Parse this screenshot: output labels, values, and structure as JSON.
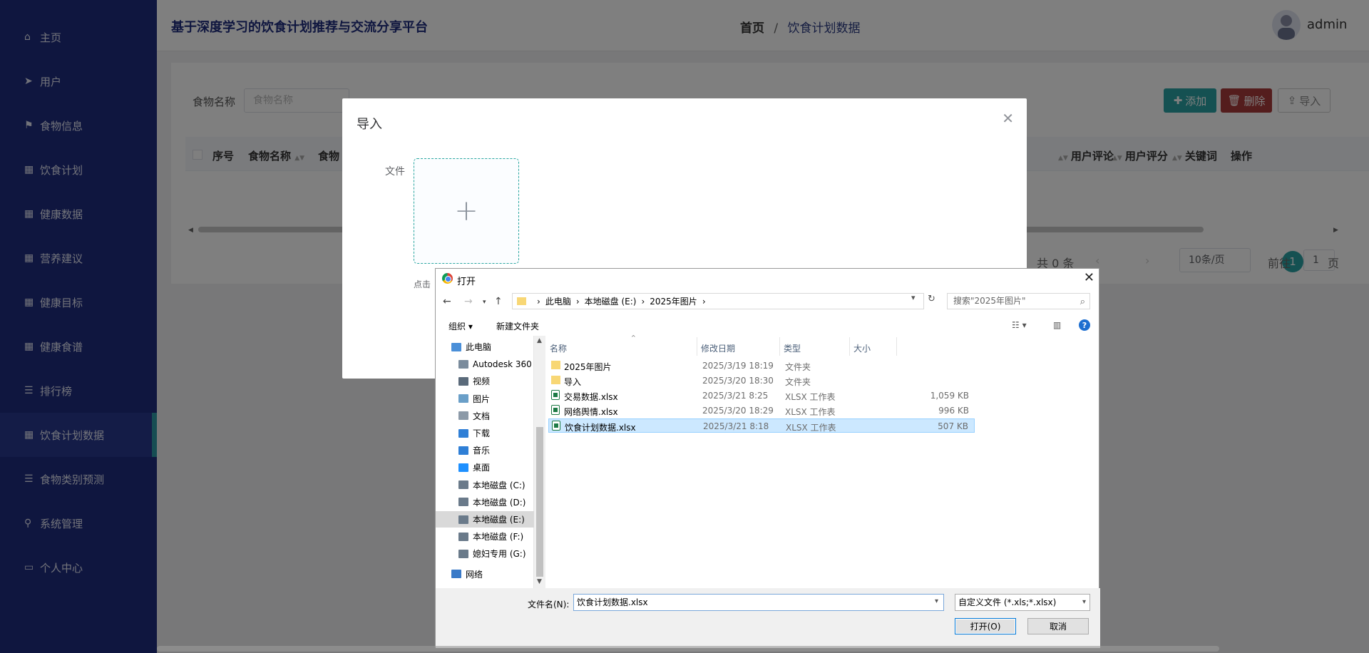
{
  "app": {
    "title": "基于深度学习的饮食计划推荐与交流分享平台",
    "username": "admin"
  },
  "breadcrumb": {
    "home": "首页",
    "sep": "/",
    "current": "饮食计划数据"
  },
  "sidebar": {
    "items": [
      {
        "label": "主页",
        "icon": "home-icon"
      },
      {
        "label": "用户",
        "icon": "send-icon"
      },
      {
        "label": "食物信息",
        "icon": "flag-icon"
      },
      {
        "label": "饮食计划",
        "icon": "grid-icon"
      },
      {
        "label": "健康数据",
        "icon": "grid-icon"
      },
      {
        "label": "营养建议",
        "icon": "grid-icon"
      },
      {
        "label": "健康目标",
        "icon": "grid-icon"
      },
      {
        "label": "健康食谱",
        "icon": "grid-icon"
      },
      {
        "label": "排行榜",
        "icon": "list-icon"
      },
      {
        "label": "饮食计划数据",
        "icon": "grid-icon",
        "active": true
      },
      {
        "label": "食物类别预测",
        "icon": "list-icon"
      },
      {
        "label": "系统管理",
        "icon": "pin-icon"
      },
      {
        "label": "个人中心",
        "icon": "calendar-icon"
      }
    ]
  },
  "search": {
    "label": "食物名称",
    "placeholder": "食物名称"
  },
  "toolbar": {
    "add": "添加",
    "delete": "删除",
    "import": "导入"
  },
  "table": {
    "headers": [
      "序号",
      "食物名称",
      "食物",
      "用户评论",
      "用户评分",
      "关键词",
      "操作"
    ]
  },
  "pager": {
    "total": "共 0 条",
    "page": "1",
    "size": "10条/页",
    "goto": "前往",
    "goto_value": "1",
    "page_unit": "页"
  },
  "import_dialog": {
    "title": "导入",
    "file_label": "文件",
    "tip": "点击"
  },
  "file_dialog": {
    "title": "打开",
    "path": [
      "此电脑",
      "本地磁盘 (E:)",
      "2025年图片"
    ],
    "search_placeholder": "搜索\"2025年图片\"",
    "organize": "组织 ▾",
    "new_folder": "新建文件夹",
    "tree": [
      {
        "label": "此电脑",
        "color": "#4a8fd8"
      },
      {
        "label": "Autodesk 360",
        "color": "#7a8b9c"
      },
      {
        "label": "视频",
        "color": "#5a6a7a"
      },
      {
        "label": "图片",
        "color": "#6a9fc8"
      },
      {
        "label": "文档",
        "color": "#8c9aa8"
      },
      {
        "label": "下载",
        "color": "#2f7fd6"
      },
      {
        "label": "音乐",
        "color": "#2f7fd6"
      },
      {
        "label": "桌面",
        "color": "#1e90ff"
      },
      {
        "label": "本地磁盘 (C:)",
        "color": "#6a7a8a"
      },
      {
        "label": "本地磁盘 (D:)",
        "color": "#6a7a8a"
      },
      {
        "label": "本地磁盘 (E:)",
        "color": "#6a7a8a",
        "selected": true
      },
      {
        "label": "本地磁盘 (F:)",
        "color": "#6a7a8a"
      },
      {
        "label": "媳妇专用 (G:)",
        "color": "#6a7a8a"
      },
      {
        "label": "网络",
        "color": "#3a7ac8"
      }
    ],
    "columns": [
      "名称",
      "修改日期",
      "类型",
      "大小"
    ],
    "files": [
      {
        "name": "2025年图片",
        "date": "2025/3/19 18:19",
        "type": "文件夹",
        "size": "",
        "kind": "folder"
      },
      {
        "name": "导入",
        "date": "2025/3/20 18:30",
        "type": "文件夹",
        "size": "",
        "kind": "folder"
      },
      {
        "name": "交易数据.xlsx",
        "date": "2025/3/21 8:25",
        "type": "XLSX 工作表",
        "size": "1,059 KB",
        "kind": "xlsx"
      },
      {
        "name": "网络舆情.xlsx",
        "date": "2025/3/20 18:29",
        "type": "XLSX 工作表",
        "size": "996 KB",
        "kind": "xlsx"
      },
      {
        "name": "饮食计划数据.xlsx",
        "date": "2025/3/21 8:18",
        "type": "XLSX 工作表",
        "size": "507 KB",
        "kind": "xlsx",
        "selected": true
      }
    ],
    "filename_label": "文件名(N):",
    "filename_value": "饮食计划数据.xlsx",
    "filetype": "自定义文件 (*.xls;*.xlsx)",
    "open_btn": "打开(O)",
    "cancel_btn": "取消"
  },
  "colors": {
    "sidebar": "#1f2c7e",
    "accent": "#2ba3a4",
    "danger": "#a93a3a"
  }
}
